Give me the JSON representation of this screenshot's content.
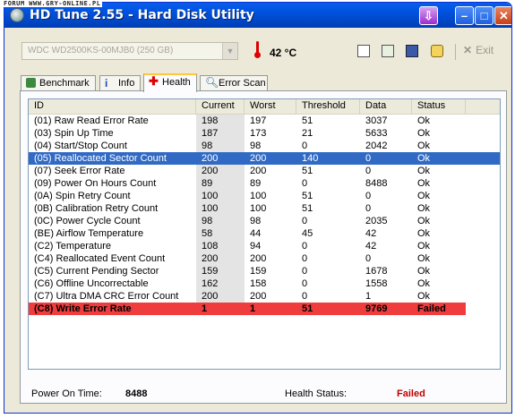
{
  "watermark": "FORUM WWW.GRY-ONLINE.PL",
  "window": {
    "title": "HD Tune 2.55 - Hard Disk Utility"
  },
  "toolbar": {
    "drive_select": "WDC WD2500KS-00MJB0 (250 GB)",
    "temperature": "42 °C",
    "exit_label": "Exit"
  },
  "tabs": [
    {
      "label": "Benchmark",
      "active": false
    },
    {
      "label": "Info",
      "active": false
    },
    {
      "label": "Health",
      "active": true
    },
    {
      "label": "Error Scan",
      "active": false
    }
  ],
  "table": {
    "columns": [
      "ID",
      "Current",
      "Worst",
      "Threshold",
      "Data",
      "Status"
    ],
    "rows": [
      {
        "id": "(01) Raw Read Error Rate",
        "current": "198",
        "worst": "197",
        "threshold": "51",
        "data": "3037",
        "status": "Ok"
      },
      {
        "id": "(03) Spin Up Time",
        "current": "187",
        "worst": "173",
        "threshold": "21",
        "data": "5633",
        "status": "Ok"
      },
      {
        "id": "(04) Start/Stop Count",
        "current": "98",
        "worst": "98",
        "threshold": "0",
        "data": "2042",
        "status": "Ok"
      },
      {
        "id": "(05) Reallocated Sector Count",
        "current": "200",
        "worst": "200",
        "threshold": "140",
        "data": "0",
        "status": "Ok",
        "selected": true
      },
      {
        "id": "(07) Seek Error Rate",
        "current": "200",
        "worst": "200",
        "threshold": "51",
        "data": "0",
        "status": "Ok"
      },
      {
        "id": "(09) Power On Hours Count",
        "current": "89",
        "worst": "89",
        "threshold": "0",
        "data": "8488",
        "status": "Ok"
      },
      {
        "id": "(0A) Spin Retry Count",
        "current": "100",
        "worst": "100",
        "threshold": "51",
        "data": "0",
        "status": "Ok"
      },
      {
        "id": "(0B) Calibration Retry Count",
        "current": "100",
        "worst": "100",
        "threshold": "51",
        "data": "0",
        "status": "Ok"
      },
      {
        "id": "(0C) Power Cycle Count",
        "current": "98",
        "worst": "98",
        "threshold": "0",
        "data": "2035",
        "status": "Ok"
      },
      {
        "id": "(BE) Airflow Temperature",
        "current": "58",
        "worst": "44",
        "threshold": "45",
        "data": "42",
        "status": "Ok"
      },
      {
        "id": "(C2) Temperature",
        "current": "108",
        "worst": "94",
        "threshold": "0",
        "data": "42",
        "status": "Ok"
      },
      {
        "id": "(C4) Reallocated Event Count",
        "current": "200",
        "worst": "200",
        "threshold": "0",
        "data": "0",
        "status": "Ok"
      },
      {
        "id": "(C5) Current Pending Sector",
        "current": "159",
        "worst": "159",
        "threshold": "0",
        "data": "1678",
        "status": "Ok"
      },
      {
        "id": "(C6) Offline Uncorrectable",
        "current": "162",
        "worst": "158",
        "threshold": "0",
        "data": "1558",
        "status": "Ok"
      },
      {
        "id": "(C7) Ultra DMA CRC Error Count",
        "current": "200",
        "worst": "200",
        "threshold": "0",
        "data": "1",
        "status": "Ok"
      },
      {
        "id": "(C8) Write Error Rate",
        "current": "1",
        "worst": "1",
        "threshold": "51",
        "data": "9769",
        "status": "Failed",
        "failed": true
      }
    ]
  },
  "footer": {
    "power_on_label": "Power On Time:",
    "power_on_value": "8488",
    "health_label": "Health Status:",
    "health_value": "Failed"
  },
  "colors": {
    "title_bar": "#0054e3",
    "selection": "#316ac5",
    "failed_row": "#ef3c3c",
    "failed_text": "#c00000"
  }
}
